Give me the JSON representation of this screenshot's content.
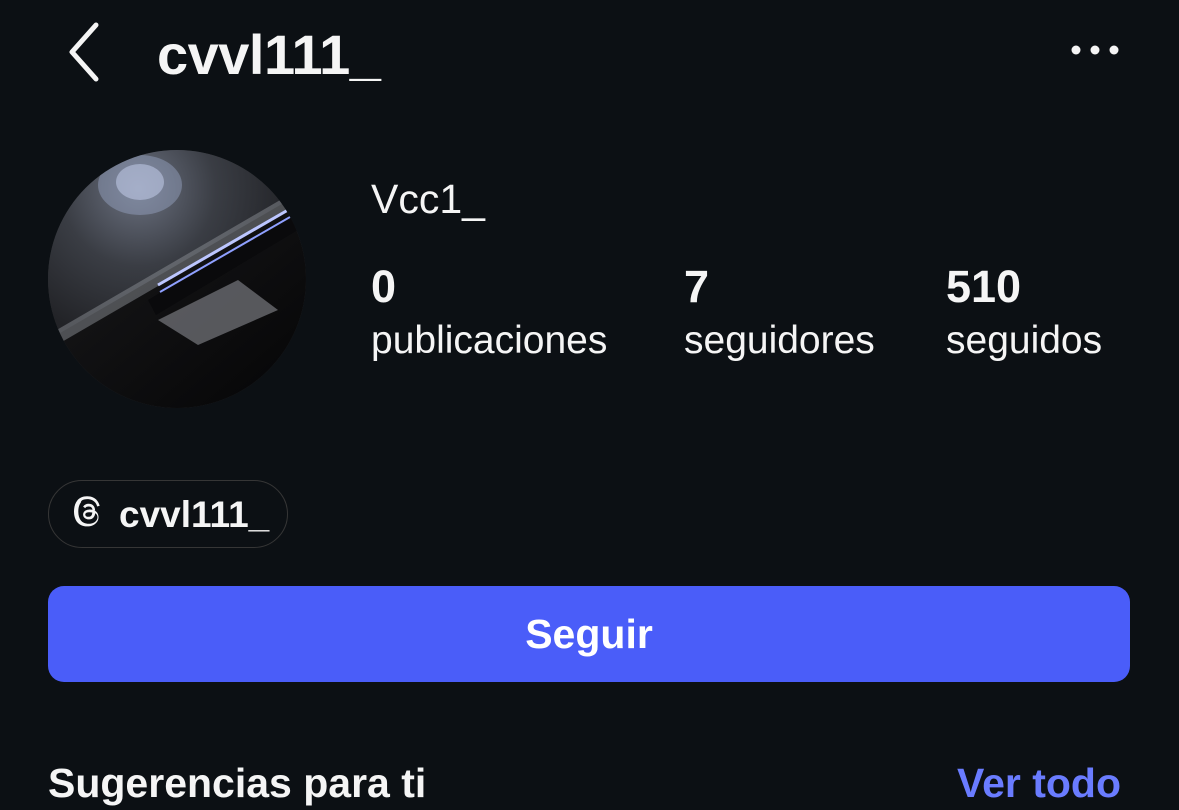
{
  "header": {
    "back_icon": "chevron-left-icon",
    "username": "cvvl111_",
    "more_icon": "more-horizontal-icon"
  },
  "profile": {
    "avatar": "profile-photo",
    "display_name": "Vcc1_",
    "stats": {
      "posts": {
        "count": "0",
        "label": "publicaciones"
      },
      "followers": {
        "count": "7",
        "label": "seguidores"
      },
      "following": {
        "count": "510",
        "label": "seguidos"
      }
    }
  },
  "threads": {
    "icon": "threads-icon",
    "handle": "cvvl111_"
  },
  "actions": {
    "follow_label": "Seguir"
  },
  "suggestions": {
    "title": "Sugerencias para ti",
    "see_all_label": "Ver todo"
  },
  "colors": {
    "background": "#0c1014",
    "primary_button": "#4a5df9",
    "link": "#6a7cff",
    "text": "#f5f5f5"
  }
}
